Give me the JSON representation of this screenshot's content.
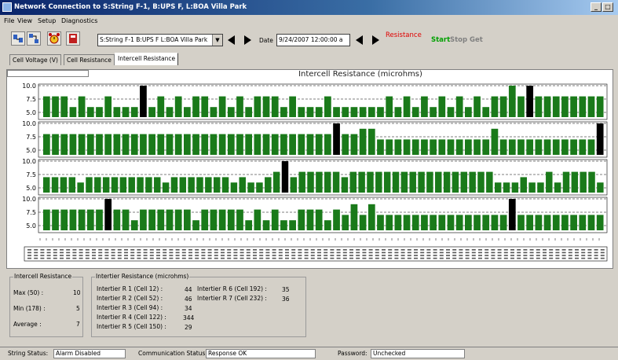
{
  "window": {
    "title": "Network Connection to S:String F-1, B:UPS F, L:BOA Villa Park",
    "minimize": "_",
    "maximize": "□"
  },
  "menu": [
    "File",
    "View",
    "Setup",
    "Diagnostics"
  ],
  "toolbar": {
    "string_select": "S:String F-1 B:UPS F L:BOA Villa Park",
    "date_label": "Date",
    "date_value": "9/24/2007 12:00:00 a",
    "mode_label": "Resistance",
    "start": "Start",
    "stop": "Stop",
    "get": "Get",
    "colors": {
      "mode": "#e00000",
      "start": "#00a000",
      "disabled": "#808080"
    }
  },
  "tabs": [
    "Cell Voltage  (V)",
    "Cell Resistance",
    "Intercell Resistance"
  ],
  "active_tab": 2,
  "chart_data": {
    "type": "bar",
    "title": "Intercell Resistance  (microhms)",
    "panels": [
      {
        "ylim": [
          5,
          10
        ],
        "yticks": [
          "10.0",
          "7.5",
          "5.0"
        ],
        "values": [
          8,
          8,
          8,
          6,
          8,
          6,
          6,
          8,
          6,
          6,
          6,
          10,
          6,
          8,
          6,
          8,
          6,
          8,
          8,
          6,
          8,
          6,
          8,
          6,
          8,
          8,
          8,
          6,
          8,
          6,
          6,
          6,
          8,
          6,
          6,
          6,
          6,
          6,
          6,
          8,
          6,
          8,
          6,
          8,
          6,
          8,
          6,
          8,
          6,
          8,
          6,
          8,
          8,
          10,
          8,
          10,
          8,
          8,
          8,
          8,
          8,
          8,
          8,
          8
        ],
        "highlight": [
          11,
          55
        ]
      },
      {
        "ylim": [
          5,
          10
        ],
        "yticks": [
          "10.0",
          "7.5",
          "5.0"
        ],
        "values": [
          8,
          8,
          8,
          8,
          8,
          8,
          8,
          8,
          8,
          8,
          8,
          8,
          8,
          8,
          8,
          8,
          8,
          8,
          8,
          8,
          8,
          8,
          8,
          8,
          8,
          8,
          8,
          8,
          8,
          8,
          8,
          8,
          8,
          10,
          8,
          8,
          9,
          9,
          7,
          7,
          7,
          7,
          7,
          7,
          7,
          7,
          7,
          7,
          7,
          7,
          7,
          9,
          7,
          7,
          7,
          7,
          7,
          7,
          7,
          7,
          7,
          7,
          7,
          10
        ],
        "highlight": [
          33,
          63
        ]
      },
      {
        "ylim": [
          5,
          10
        ],
        "yticks": [
          "10.0",
          "7.5",
          "5.0"
        ],
        "values": [
          7,
          7,
          7,
          7,
          6,
          7,
          7,
          7,
          7,
          7,
          7,
          7,
          7,
          7,
          6,
          7,
          7,
          7,
          7,
          7,
          7,
          7,
          6,
          7,
          6,
          6,
          7,
          8,
          10,
          7,
          8,
          8,
          8,
          8,
          8,
          7,
          8,
          8,
          8,
          8,
          8,
          8,
          8,
          8,
          8,
          8,
          8,
          8,
          8,
          8,
          8,
          8,
          8,
          6,
          6,
          6,
          7,
          6,
          6,
          8,
          6,
          8,
          8,
          8,
          8,
          6
        ],
        "highlight": [
          28
        ]
      },
      {
        "ylim": [
          5,
          10
        ],
        "yticks": [
          "10.0",
          "7.5",
          "5.0"
        ],
        "values": [
          8,
          8,
          8,
          8,
          8,
          8,
          8,
          10,
          8,
          8,
          6,
          8,
          8,
          8,
          8,
          8,
          8,
          6,
          8,
          8,
          8,
          8,
          8,
          6,
          8,
          6,
          8,
          6,
          6,
          8,
          8,
          8,
          6,
          8,
          7,
          9,
          7,
          9,
          7,
          7,
          7,
          7,
          7,
          7,
          7,
          7,
          7,
          7,
          7,
          7,
          7,
          7,
          7,
          10,
          7,
          7,
          7,
          7,
          7,
          7,
          7,
          7,
          7,
          7
        ],
        "highlight": [
          7,
          53
        ]
      }
    ],
    "bar_color": "#1a7a1a",
    "highlight_color": "#000000"
  },
  "intercell_summary": {
    "title": "Intercell Resistance",
    "rows": [
      {
        "label": "Max (50) :",
        "value": "10"
      },
      {
        "label": "Min (178) :",
        "value": "5"
      },
      {
        "label": "Average :",
        "value": "7"
      }
    ]
  },
  "intertier": {
    "title": "Intertier Resistance (microhms)",
    "col1": [
      {
        "label": "Intertier R 1 (Cell 12) :",
        "value": "44"
      },
      {
        "label": "Intertier R 2 (Cell 52) :",
        "value": "46"
      },
      {
        "label": "Intertier R 3 (Cell 94) :",
        "value": "34"
      },
      {
        "label": "Intertier R 4 (Cell 122) :",
        "value": "344"
      },
      {
        "label": "Intertier R 5 (Cell 150) :",
        "value": "29"
      }
    ],
    "col2": [
      {
        "label": "Intertier R 6 (Cell 192) :",
        "value": "35"
      },
      {
        "label": "Intertier R 7 (Cell 232) :",
        "value": "36"
      }
    ]
  },
  "status": {
    "string_label": "String Status:",
    "string_value": "Alarm Disabled",
    "comm_label": "Communication Status:",
    "comm_value": "Response OK",
    "password_label": "Password:",
    "password_value": "Unchecked"
  }
}
